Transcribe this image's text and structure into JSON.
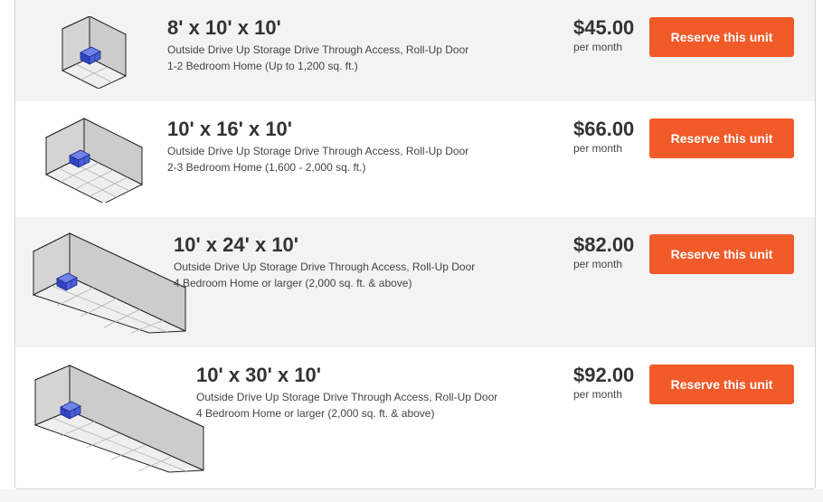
{
  "units": [
    {
      "size": "8' x 10' x 10'",
      "features": "Outside Drive Up Storage Drive Through Access, Roll-Up Door",
      "fits": "1-2 Bedroom Home (Up to 1,200 sq. ft.)",
      "price": "$45.00",
      "period": "per month",
      "button": "Reserve this unit"
    },
    {
      "size": "10' x 16' x 10'",
      "features": "Outside Drive Up Storage Drive Through Access, Roll-Up Door",
      "fits": "2-3 Bedroom Home (1,600 - 2,000 sq. ft.)",
      "price": "$66.00",
      "period": "per month",
      "button": "Reserve this unit"
    },
    {
      "size": "10' x 24' x 10'",
      "features": "Outside Drive Up Storage Drive Through Access, Roll-Up Door",
      "fits": "4 Bedroom Home or larger (2,000 sq. ft. & above)",
      "price": "$82.00",
      "period": "per month",
      "button": "Reserve this unit"
    },
    {
      "size": "10' x 30' x 10'",
      "features": "Outside Drive Up Storage Drive Through Access, Roll-Up Door",
      "fits": "4 Bedroom Home or larger (2,000 sq. ft. & above)",
      "price": "$92.00",
      "period": "per month",
      "button": "Reserve this unit"
    }
  ],
  "colors": {
    "button": "#f15a29",
    "row_alt": "#f3f3f3",
    "furniture": "#4a5fd6"
  }
}
